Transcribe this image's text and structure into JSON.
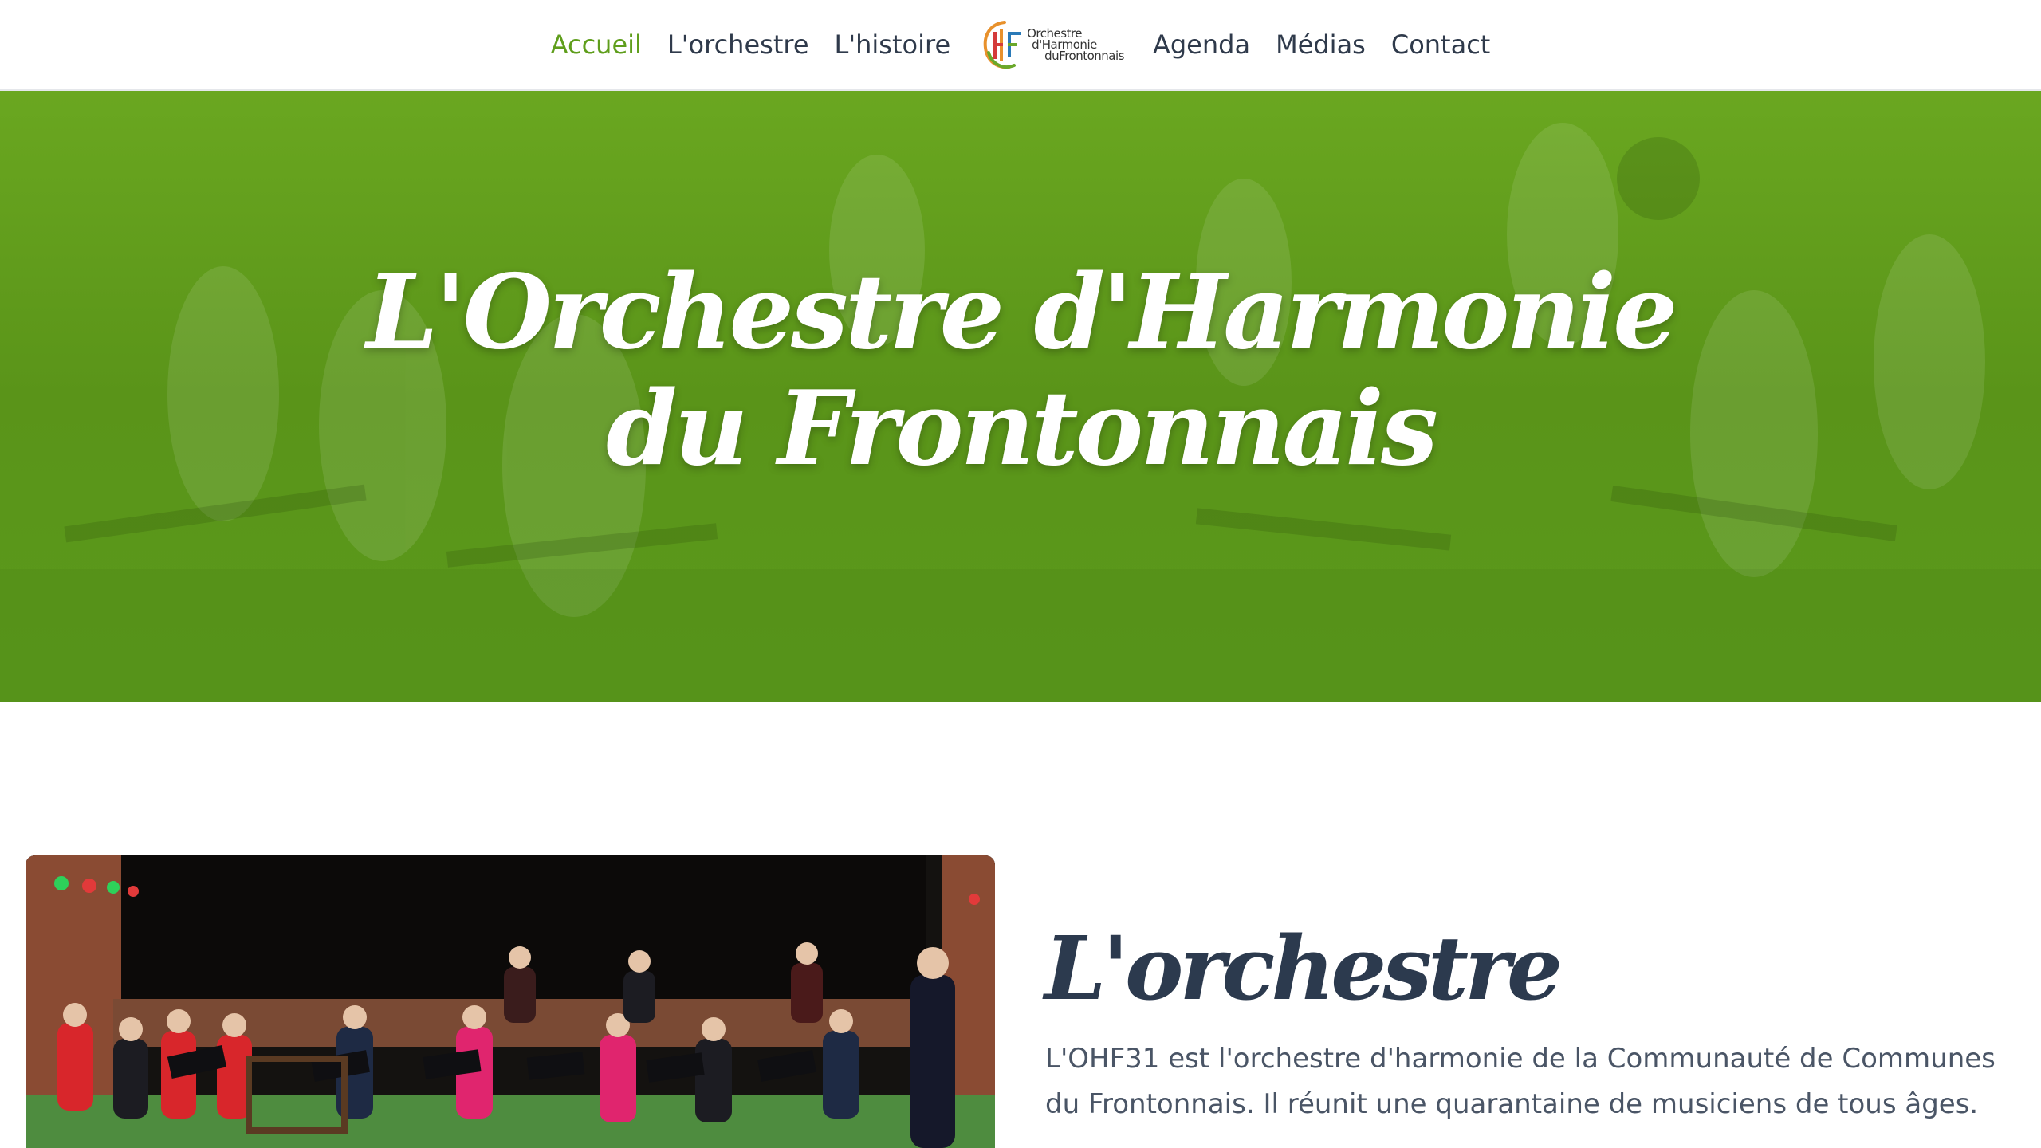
{
  "nav": {
    "links_left": [
      {
        "label": "Accueil",
        "active": true
      },
      {
        "label": "L'orchestre",
        "active": false
      },
      {
        "label": "L'histoire",
        "active": false
      }
    ],
    "logo": {
      "line1": "Orchestre",
      "line2": "d'Harmonie",
      "line3": "duFrontonnais",
      "monogram": "OHF",
      "colors": [
        "#e8912c",
        "#6aa82a",
        "#d43a3a",
        "#2a7ab8"
      ]
    },
    "links_right": [
      {
        "label": "Agenda",
        "active": false
      },
      {
        "label": "Médias",
        "active": false
      },
      {
        "label": "Contact",
        "active": false
      }
    ],
    "active_color": "#5f9e1c",
    "text_color": "#2f3a4b"
  },
  "hero": {
    "title_line1": "L'Orchestre d'Harmonie",
    "title_line2": "du Frontonnais",
    "overlay_color": "#5e9a1c"
  },
  "orchestre_section": {
    "photo_icon": "orchestra-photo",
    "title": "L'orchestre",
    "text": "L'OHF31 est l'orchestre d'harmonie de la Communauté de Communes du Frontonnais. Il réunit une quarantaine de musiciens de tous âges."
  }
}
